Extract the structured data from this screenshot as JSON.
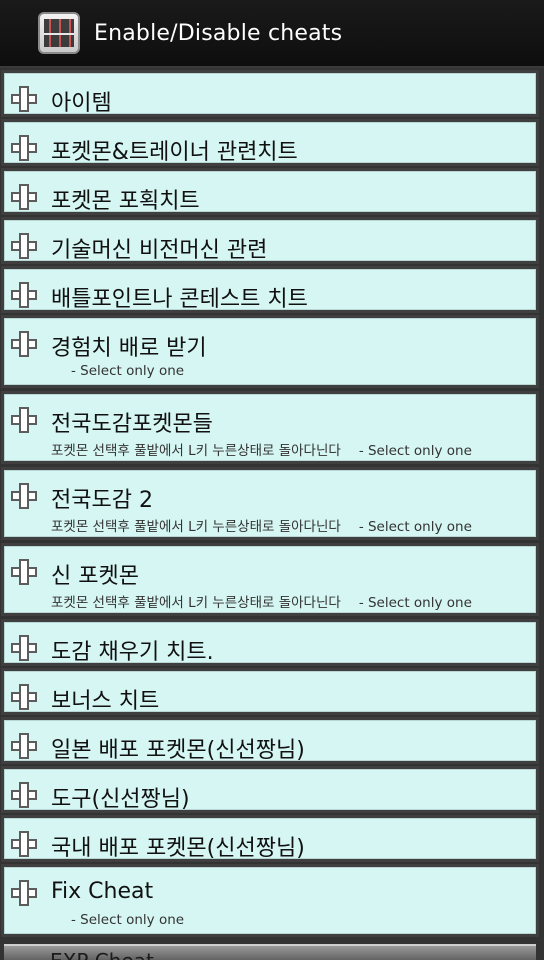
{
  "header": {
    "title": "Enable/Disable cheats",
    "icon": "cheat-app-icon"
  },
  "items": [
    {
      "label": "아이템"
    },
    {
      "label": "포켓몬&트레이너 관련치트"
    },
    {
      "label": "포켓몬 포획치트"
    },
    {
      "label": "기술머신 비전머신 관련"
    },
    {
      "label": "배틀포인트나 콘테스트 치트"
    },
    {
      "label": "경험치 배로 받기",
      "select_note": "- Select only one"
    },
    {
      "label": "전국도감포켓몬들",
      "desc": "포켓몬 선택후 풀밭에서 L키 누른상태로 돌아다닌다",
      "select_note": "- Select only one"
    },
    {
      "label": "전국도감 2",
      "desc": "포켓몬 선택후 풀밭에서 L키 누른상태로 돌아다닌다",
      "select_note": "- Select only one"
    },
    {
      "label": "신 포켓몬",
      "desc": "포켓몬 선택후 풀밭에서 L키 누른상태로 돌아다닌다",
      "select_note": "- Select only one"
    },
    {
      "label": "도감 채우기 치트."
    },
    {
      "label": "보너스 치트"
    },
    {
      "label": "일본 배포 포켓몬(신선짱님)"
    },
    {
      "label": "도구(신선짱님)"
    },
    {
      "label": "국내 배포 포켓몬(신선짱님)"
    },
    {
      "label": "Fix Cheat",
      "select_note": "- Select only one"
    }
  ],
  "partial_item": {
    "label": "EXP Cheat"
  },
  "colors": {
    "item_bg": "#d5f6f3",
    "titlebar_bg": "#121212",
    "divider": "#3f3f3f"
  }
}
